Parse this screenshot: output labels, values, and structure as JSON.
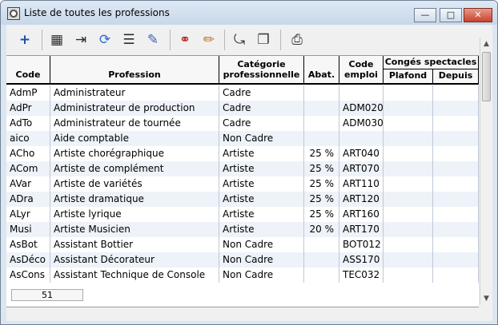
{
  "window": {
    "title": "Liste de toutes les professions"
  },
  "toolbar": {
    "icons": [
      "plus-icon",
      "grid-icon",
      "export-icon",
      "refresh-icon",
      "list-icon",
      "clipboard-icon",
      "glasses-icon",
      "pencil-icon",
      "arrow-icon",
      "copy-icon",
      "printer-icon"
    ]
  },
  "table": {
    "columns": {
      "code": "Code",
      "profession": "Profession",
      "categorie": "Catégorie professionnelle",
      "abat": "Abat.",
      "code_emploi": "Code emploi",
      "conges": "Congés spectacles",
      "plafond": "Plafond",
      "depuis": "Depuis"
    },
    "rows": [
      {
        "code": "AdmP",
        "profession": "Administrateur",
        "categorie": "Cadre",
        "abat": "",
        "code_emploi": ""
      },
      {
        "code": "AdPr",
        "profession": "Administrateur de production",
        "categorie": "Cadre",
        "abat": "",
        "code_emploi": "ADM020"
      },
      {
        "code": "AdTo",
        "profession": "Administrateur de tournée",
        "categorie": "Cadre",
        "abat": "",
        "code_emploi": "ADM030"
      },
      {
        "code": "aico",
        "profession": "Aide comptable",
        "categorie": "Non Cadre",
        "abat": "",
        "code_emploi": ""
      },
      {
        "code": "ACho",
        "profession": "Artiste chorégraphique",
        "categorie": "Artiste",
        "abat": "25 %",
        "code_emploi": "ART040"
      },
      {
        "code": "ACom",
        "profession": "Artiste de complément",
        "categorie": "Artiste",
        "abat": "25 %",
        "code_emploi": "ART070"
      },
      {
        "code": "AVar",
        "profession": "Artiste de variétés",
        "categorie": "Artiste",
        "abat": "25 %",
        "code_emploi": "ART110"
      },
      {
        "code": "ADra",
        "profession": "Artiste dramatique",
        "categorie": "Artiste",
        "abat": "25 %",
        "code_emploi": "ART120"
      },
      {
        "code": "ALyr",
        "profession": "Artiste lyrique",
        "categorie": "Artiste",
        "abat": "25 %",
        "code_emploi": "ART160"
      },
      {
        "code": "Musi",
        "profession": "Artiste Musicien",
        "categorie": "Artiste",
        "abat": "20 %",
        "code_emploi": "ART170"
      },
      {
        "code": "AsBot",
        "profession": "Assistant Bottier",
        "categorie": "Non Cadre",
        "abat": "",
        "code_emploi": "BOT012"
      },
      {
        "code": "AsDéco",
        "profession": "Assistant Décorateur",
        "categorie": "Non Cadre",
        "abat": "",
        "code_emploi": "ASS170"
      },
      {
        "code": "AsCons",
        "profession": "Assistant Technique de Console",
        "categorie": "Non Cadre",
        "abat": "",
        "code_emploi": "TEC032"
      }
    ]
  },
  "status": {
    "count": "51"
  }
}
